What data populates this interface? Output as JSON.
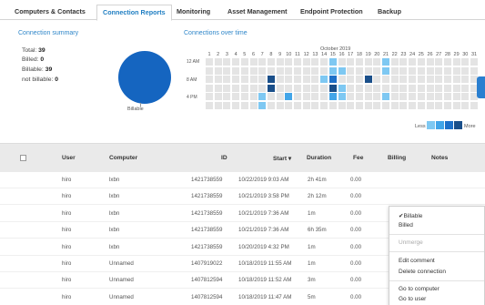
{
  "tabs": [
    {
      "label": "Computers & Contacts"
    },
    {
      "label": "Connection Reports"
    },
    {
      "label": "Monitoring"
    },
    {
      "label": "Asset Management"
    },
    {
      "label": "Endpoint Protection"
    },
    {
      "label": "Backup"
    }
  ],
  "summary": {
    "title": "Connection summary",
    "total_label": "Total:",
    "total_value": "39",
    "billed_label": "Billed:",
    "billed_value": "0",
    "billable_label": "Billable:",
    "billable_value": "39",
    "notbillable_label": "not billable:",
    "notbillable_value": "0",
    "pie_label": "Billable"
  },
  "chart_data": {
    "type": "heatmap",
    "title": "Connections over time",
    "month": "October 2019",
    "x": [
      "1",
      "2",
      "3",
      "4",
      "5",
      "6",
      "7",
      "8",
      "9",
      "10",
      "11",
      "12",
      "13",
      "14",
      "15",
      "16",
      "17",
      "18",
      "19",
      "20",
      "21",
      "22",
      "23",
      "24",
      "25",
      "26",
      "27",
      "28",
      "29",
      "30",
      "31"
    ],
    "y_labels": [
      "12 AM",
      "8 AM",
      "4 PM"
    ],
    "rows": 6,
    "values": [
      [
        0,
        0,
        0,
        0,
        0,
        0,
        0,
        0,
        0,
        0,
        0,
        0,
        0,
        0,
        1,
        0,
        0,
        0,
        0,
        0,
        1,
        0,
        0,
        0,
        0,
        0,
        0,
        0,
        0,
        0,
        0
      ],
      [
        0,
        0,
        0,
        0,
        0,
        0,
        0,
        0,
        0,
        0,
        0,
        0,
        0,
        0,
        1,
        1,
        0,
        0,
        0,
        0,
        1,
        0,
        0,
        0,
        0,
        0,
        0,
        0,
        0,
        0,
        0
      ],
      [
        0,
        0,
        0,
        0,
        0,
        0,
        0,
        4,
        0,
        0,
        0,
        0,
        0,
        1,
        3,
        0,
        0,
        0,
        4,
        0,
        0,
        0,
        0,
        0,
        0,
        0,
        0,
        0,
        0,
        0,
        0
      ],
      [
        0,
        0,
        0,
        0,
        0,
        0,
        0,
        4,
        0,
        0,
        0,
        0,
        0,
        0,
        4,
        1,
        0,
        0,
        0,
        0,
        0,
        0,
        0,
        0,
        0,
        0,
        0,
        0,
        0,
        0,
        0
      ],
      [
        0,
        0,
        0,
        0,
        0,
        0,
        1,
        0,
        0,
        2,
        0,
        0,
        0,
        0,
        2,
        1,
        0,
        0,
        0,
        0,
        1,
        0,
        0,
        0,
        0,
        0,
        0,
        0,
        0,
        0,
        0
      ],
      [
        0,
        0,
        0,
        0,
        0,
        0,
        1,
        0,
        0,
        0,
        0,
        0,
        0,
        0,
        0,
        0,
        0,
        0,
        0,
        0,
        0,
        0,
        0,
        0,
        0,
        0,
        0,
        0,
        0,
        0,
        0
      ]
    ],
    "legend_less": "Less",
    "legend_more": "More",
    "palette": [
      "#e4e4e4",
      "#7ec8f2",
      "#42a5e8",
      "#1e70c8",
      "#1a4f8a"
    ]
  },
  "table": {
    "headers": {
      "user": "User",
      "computer": "Computer",
      "id": "ID",
      "start": "Start ▾",
      "duration": "Duration",
      "fee": "Fee",
      "billing": "Billing",
      "notes": "Notes"
    },
    "rows": [
      {
        "user": "hiro",
        "computer": "lxbn",
        "id": "1421738559",
        "start": "10/22/2019 9:03 AM",
        "duration": "2h 41m",
        "fee": "0.00"
      },
      {
        "user": "hiro",
        "computer": "lxbn",
        "id": "1421738559",
        "start": "10/21/2019 3:58 PM",
        "duration": "2h 12m",
        "fee": "0.00"
      },
      {
        "user": "hiro",
        "computer": "lxbn",
        "id": "1421738559",
        "start": "10/21/2019 7:36 AM",
        "duration": "1m",
        "fee": "0.00"
      },
      {
        "user": "hiro",
        "computer": "lxbn",
        "id": "1421738559",
        "start": "10/21/2019 7:36 AM",
        "duration": "6h 35m",
        "fee": "0.00"
      },
      {
        "user": "hiro",
        "computer": "lxbn",
        "id": "1421738559",
        "start": "10/20/2019 4:32 PM",
        "duration": "1m",
        "fee": "0.00"
      },
      {
        "user": "hiro",
        "computer": "Unnamed",
        "id": "1407919022",
        "start": "10/18/2019 11:55 AM",
        "duration": "1m",
        "fee": "0.00"
      },
      {
        "user": "hiro",
        "computer": "Unnamed",
        "id": "1407812594",
        "start": "10/18/2019 11:52 AM",
        "duration": "3m",
        "fee": "0.00"
      },
      {
        "user": "hiro",
        "computer": "Unnamed",
        "id": "1407812594",
        "start": "10/18/2019 11:47 AM",
        "duration": "5m",
        "fee": "0.00"
      }
    ]
  },
  "context_menu": {
    "items": [
      {
        "label": "✔Billable",
        "disabled": false
      },
      {
        "label": "Billed",
        "disabled": false
      },
      {
        "label": "Unmerge",
        "disabled": true
      },
      {
        "label": "Edit comment",
        "disabled": false
      },
      {
        "label": "Delete connection",
        "disabled": false
      },
      {
        "label": "Go to computer",
        "disabled": false
      },
      {
        "label": "Go to user",
        "disabled": false
      }
    ]
  }
}
